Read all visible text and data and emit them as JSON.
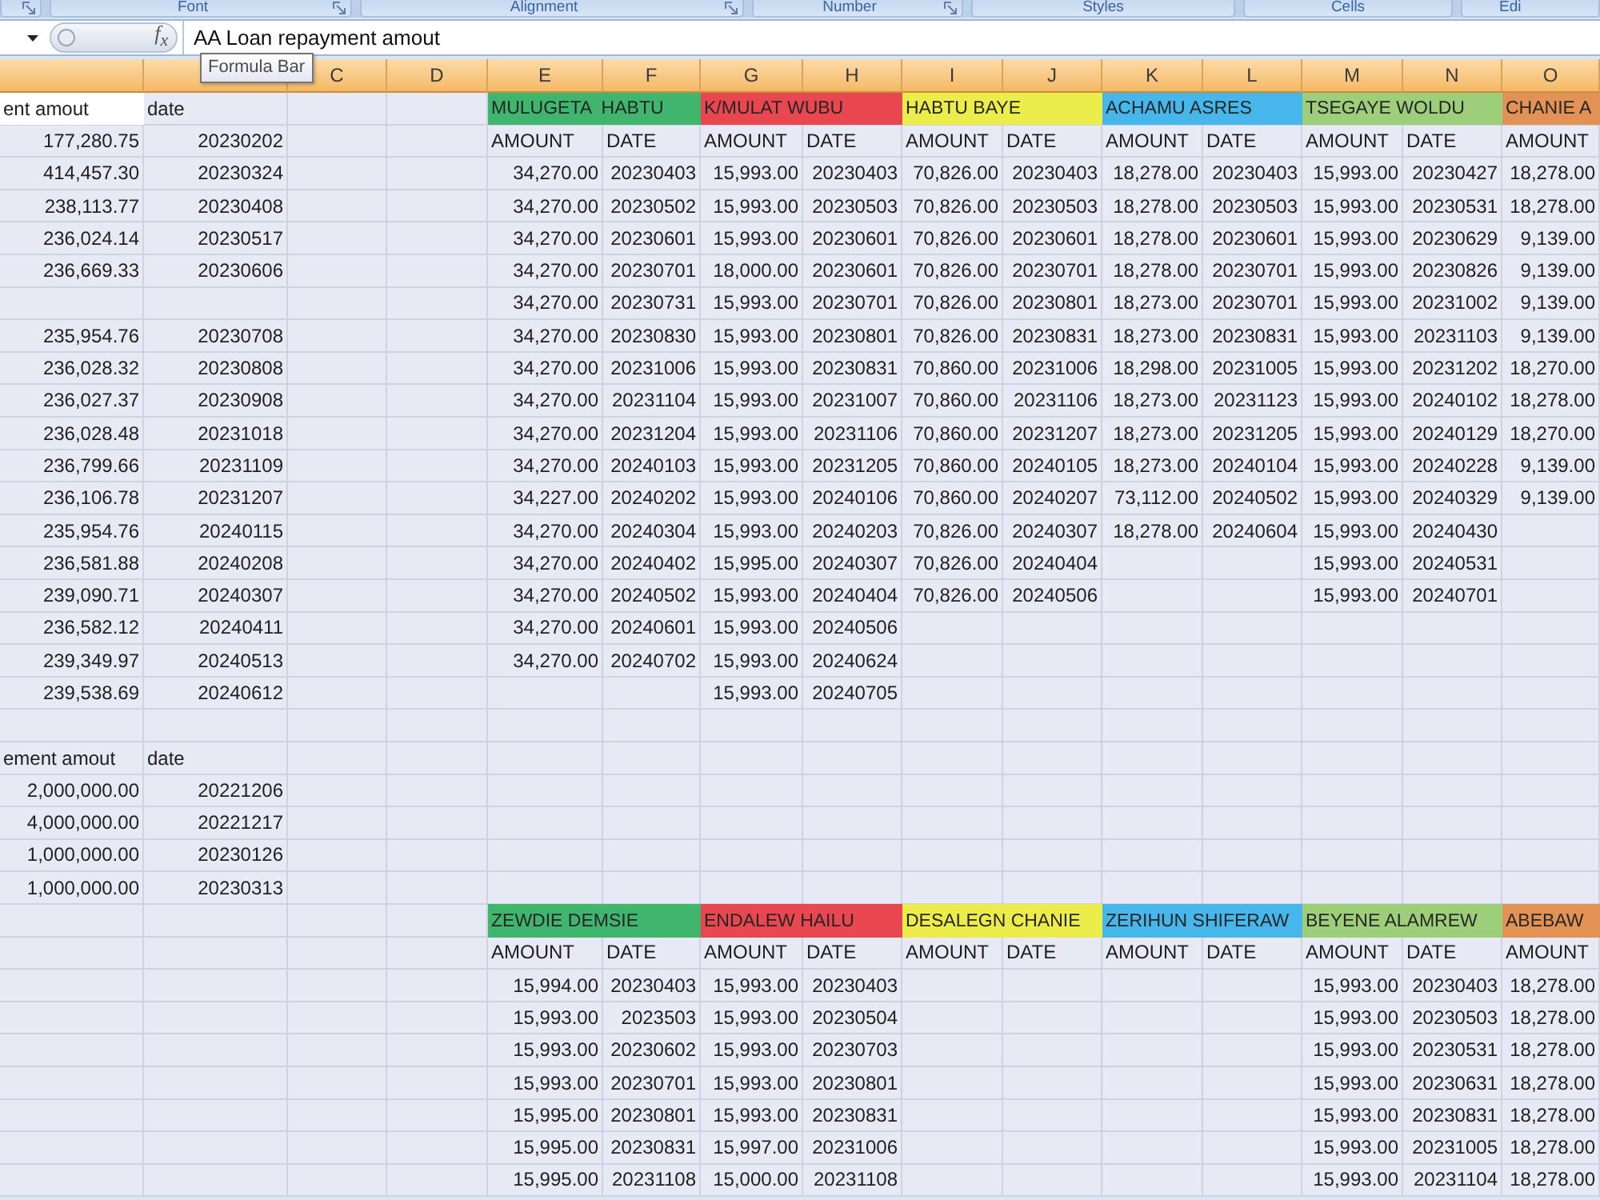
{
  "ribbon_groups": [
    {
      "dialog_launcher": true
    },
    {
      "label": "Font",
      "dialog_launcher": true
    },
    {
      "label": "Alignment",
      "dialog_launcher": true
    },
    {
      "label": "Number",
      "dialog_launcher": true
    },
    {
      "label": "Styles",
      "dialog_launcher": false
    },
    {
      "label": "Cells",
      "dialog_launcher": false
    },
    {
      "label": "Edi",
      "dialog_launcher": false
    }
  ],
  "formula_bar": {
    "function_label": "f$_{x}$",
    "formula": "AA Loan repayment amout",
    "tooltip": "Formula Bar"
  },
  "columns": [
    {
      "selected": true
    },
    {
      "selected": true
    },
    {
      "label": "C",
      "selected": true
    },
    {
      "label": "D",
      "selected": true
    },
    {
      "label": "E",
      "selected": true
    },
    {
      "label": "F",
      "selected": true
    },
    {
      "label": "G",
      "selected": true
    },
    {
      "label": "H",
      "selected": true
    },
    {
      "label": "I",
      "selected": true
    },
    {
      "label": "J",
      "selected": true
    },
    {
      "label": "K",
      "selected": true
    },
    {
      "label": "L",
      "selected": true
    },
    {
      "label": "M",
      "selected": true
    },
    {
      "label": "N",
      "selected": true
    },
    {
      "label": "O",
      "selected": true
    }
  ],
  "rows": [
    {
      "cells": [
        {
          "kind": "text",
          "text": "ent amout",
          "active": true
        },
        {
          "kind": "text",
          "text": "date",
          "active": false
        },
        null,
        null,
        {
          "kind": "name",
          "text": "MULUGETA  HABTU",
          "color": "#3fb56e",
          "active": false
        },
        {
          "kind": "name",
          "text": "K/MULAT WUBU",
          "color": "#e8474f",
          "active": false
        },
        {
          "kind": "name",
          "text": "HABTU BAYE",
          "color": "#ecec4a",
          "active": false
        },
        {
          "kind": "name",
          "text": "ACHAMU ASRES",
          "color": "#47b6ea",
          "active": false
        },
        {
          "kind": "name",
          "text": "TSEGAYE WOLDU",
          "color": "#9dcf7a",
          "active": false
        },
        {
          "kind": "name",
          "text": "CHANIE A",
          "color": "#e39255",
          "active": false
        }
      ]
    },
    {
      "cells": [
        {
          "kind": "number",
          "text": "177,280.75",
          "active": false
        },
        {
          "kind": "number",
          "text": "20230202",
          "active": false
        },
        null,
        null,
        {
          "kind": "text",
          "text": "AMOUNT",
          "active": false
        },
        {
          "kind": "text",
          "text": "DATE",
          "active": false
        },
        {
          "kind": "text",
          "text": "AMOUNT",
          "active": false
        },
        {
          "kind": "text",
          "text": "DATE",
          "active": false
        },
        {
          "kind": "text",
          "text": "AMOUNT",
          "active": false
        },
        {
          "kind": "text",
          "text": "DATE",
          "active": false
        },
        {
          "kind": "text",
          "text": "AMOUNT",
          "active": false
        },
        {
          "kind": "text",
          "text": "DATE",
          "active": false
        },
        {
          "kind": "text",
          "text": "AMOUNT",
          "active": false
        },
        {
          "kind": "text",
          "text": "DATE",
          "active": false
        },
        {
          "kind": "text",
          "text": "AMOUNT",
          "active": false
        }
      ]
    },
    {
      "cells": [
        {
          "kind": "number",
          "text": "414,457.30",
          "active": false
        },
        {
          "kind": "number",
          "text": "20230324",
          "active": false
        },
        null,
        null,
        {
          "kind": "number",
          "text": "34,270.00",
          "active": false
        },
        {
          "kind": "number",
          "text": "20230403",
          "active": false
        },
        {
          "kind": "number",
          "text": "15,993.00",
          "active": false
        },
        {
          "kind": "number",
          "text": "20230403",
          "active": false
        },
        {
          "kind": "number",
          "text": "70,826.00",
          "active": false
        },
        {
          "kind": "number",
          "text": "20230403",
          "active": false
        },
        {
          "kind": "number",
          "text": "18,278.00",
          "active": false
        },
        {
          "kind": "number",
          "text": "20230403",
          "active": false
        },
        {
          "kind": "number",
          "text": "15,993.00",
          "active": false
        },
        {
          "kind": "number",
          "text": "20230427",
          "active": false
        },
        {
          "kind": "number",
          "text": "18,278.00",
          "active": false
        }
      ]
    },
    {
      "cells": [
        {
          "kind": "number",
          "text": "238,113.77",
          "active": false
        },
        {
          "kind": "number",
          "text": "20230408",
          "active": false
        },
        null,
        null,
        {
          "kind": "number",
          "text": "34,270.00",
          "active": false
        },
        {
          "kind": "number",
          "text": "20230502",
          "active": false
        },
        {
          "kind": "number",
          "text": "15,993.00",
          "active": false
        },
        {
          "kind": "number",
          "text": "20230503",
          "active": false
        },
        {
          "kind": "number",
          "text": "70,826.00",
          "active": false
        },
        {
          "kind": "number",
          "text": "20230503",
          "active": false
        },
        {
          "kind": "number",
          "text": "18,278.00",
          "active": false
        },
        {
          "kind": "number",
          "text": "20230503",
          "active": false
        },
        {
          "kind": "number",
          "text": "15,993.00",
          "active": false
        },
        {
          "kind": "number",
          "text": "20230531",
          "active": false
        },
        {
          "kind": "number",
          "text": "18,278.00",
          "active": false
        }
      ]
    },
    {
      "cells": [
        {
          "kind": "number",
          "text": "236,024.14",
          "active": false
        },
        {
          "kind": "number",
          "text": "20230517",
          "active": false
        },
        null,
        null,
        {
          "kind": "number",
          "text": "34,270.00",
          "active": false
        },
        {
          "kind": "number",
          "text": "20230601",
          "active": false
        },
        {
          "kind": "number",
          "text": "15,993.00",
          "active": false
        },
        {
          "kind": "number",
          "text": "20230601",
          "active": false
        },
        {
          "kind": "number",
          "text": "70,826.00",
          "active": false
        },
        {
          "kind": "number",
          "text": "20230601",
          "active": false
        },
        {
          "kind": "number",
          "text": "18,278.00",
          "active": false
        },
        {
          "kind": "number",
          "text": "20230601",
          "active": false
        },
        {
          "kind": "number",
          "text": "15,993.00",
          "active": false
        },
        {
          "kind": "number",
          "text": "20230629",
          "active": false
        },
        {
          "kind": "number",
          "text": "9,139.00",
          "active": false
        }
      ]
    },
    {
      "cells": [
        {
          "kind": "number",
          "text": "236,669.33",
          "active": false
        },
        {
          "kind": "number",
          "text": "20230606",
          "active": false
        },
        null,
        null,
        {
          "kind": "number",
          "text": "34,270.00",
          "active": false
        },
        {
          "kind": "number",
          "text": "20230701",
          "active": false
        },
        {
          "kind": "number",
          "text": "18,000.00",
          "active": false
        },
        {
          "kind": "number",
          "text": "20230601",
          "active": false
        },
        {
          "kind": "number",
          "text": "70,826.00",
          "active": false
        },
        {
          "kind": "number",
          "text": "20230701",
          "active": false
        },
        {
          "kind": "number",
          "text": "18,278.00",
          "active": false
        },
        {
          "kind": "number",
          "text": "20230701",
          "active": false
        },
        {
          "kind": "number",
          "text": "15,993.00",
          "active": false
        },
        {
          "kind": "number",
          "text": "20230826",
          "active": false
        },
        {
          "kind": "number",
          "text": "9,139.00",
          "active": false
        }
      ]
    },
    {
      "cells": [
        null,
        null,
        null,
        null,
        {
          "kind": "number",
          "text": "34,270.00",
          "active": false
        },
        {
          "kind": "number",
          "text": "20230731",
          "active": false
        },
        {
          "kind": "number",
          "text": "15,993.00",
          "active": false
        },
        {
          "kind": "number",
          "text": "20230701",
          "active": false
        },
        {
          "kind": "number",
          "text": "70,826.00",
          "active": false
        },
        {
          "kind": "number",
          "text": "20230801",
          "active": false
        },
        {
          "kind": "number",
          "text": "18,273.00",
          "active": false
        },
        {
          "kind": "number",
          "text": "20230701",
          "active": false
        },
        {
          "kind": "number",
          "text": "15,993.00",
          "active": false
        },
        {
          "kind": "number",
          "text": "20231002",
          "active": false
        },
        {
          "kind": "number",
          "text": "9,139.00",
          "active": false
        }
      ]
    },
    {
      "cells": [
        {
          "kind": "number",
          "text": "235,954.76",
          "active": false
        },
        {
          "kind": "number",
          "text": "20230708",
          "active": false
        },
        null,
        null,
        {
          "kind": "number",
          "text": "34,270.00",
          "active": false
        },
        {
          "kind": "number",
          "text": "20230830",
          "active": false
        },
        {
          "kind": "number",
          "text": "15,993.00",
          "active": false
        },
        {
          "kind": "number",
          "text": "20230801",
          "active": false
        },
        {
          "kind": "number",
          "text": "70,826.00",
          "active": false
        },
        {
          "kind": "number",
          "text": "20230831",
          "active": false
        },
        {
          "kind": "number",
          "text": "18,273.00",
          "active": false
        },
        {
          "kind": "number",
          "text": "20230831",
          "active": false
        },
        {
          "kind": "number",
          "text": "15,993.00",
          "active": false
        },
        {
          "kind": "number",
          "text": "20231103",
          "active": false
        },
        {
          "kind": "number",
          "text": "9,139.00",
          "active": false
        }
      ]
    },
    {
      "cells": [
        {
          "kind": "number",
          "text": "236,028.32",
          "active": false
        },
        {
          "kind": "number",
          "text": "20230808",
          "active": false
        },
        null,
        null,
        {
          "kind": "number",
          "text": "34,270.00",
          "active": false
        },
        {
          "kind": "number",
          "text": "20231006",
          "active": false
        },
        {
          "kind": "number",
          "text": "15,993.00",
          "active": false
        },
        {
          "kind": "number",
          "text": "20230831",
          "active": false
        },
        {
          "kind": "number",
          "text": "70,860.00",
          "active": false
        },
        {
          "kind": "number",
          "text": "20231006",
          "active": false
        },
        {
          "kind": "number",
          "text": "18,298.00",
          "active": false
        },
        {
          "kind": "number",
          "text": "20231005",
          "active": false
        },
        {
          "kind": "number",
          "text": "15,993.00",
          "active": false
        },
        {
          "kind": "number",
          "text": "20231202",
          "active": false
        },
        {
          "kind": "number",
          "text": "18,270.00",
          "active": false
        }
      ]
    },
    {
      "cells": [
        {
          "kind": "number",
          "text": "236,027.37",
          "active": false
        },
        {
          "kind": "number",
          "text": "20230908",
          "active": false
        },
        null,
        null,
        {
          "kind": "number",
          "text": "34,270.00",
          "active": false
        },
        {
          "kind": "number",
          "text": "20231104",
          "active": false
        },
        {
          "kind": "number",
          "text": "15,993.00",
          "active": false
        },
        {
          "kind": "number",
          "text": "20231007",
          "active": false
        },
        {
          "kind": "number",
          "text": "70,860.00",
          "active": false
        },
        {
          "kind": "number",
          "text": "20231106",
          "active": false
        },
        {
          "kind": "number",
          "text": "18,273.00",
          "active": false
        },
        {
          "kind": "number",
          "text": "20231123",
          "active": false
        },
        {
          "kind": "number",
          "text": "15,993.00",
          "active": false
        },
        {
          "kind": "number",
          "text": "20240102",
          "active": false
        },
        {
          "kind": "number",
          "text": "18,278.00",
          "active": false
        }
      ]
    },
    {
      "cells": [
        {
          "kind": "number",
          "text": "236,028.48",
          "active": false
        },
        {
          "kind": "number",
          "text": "20231018",
          "active": false
        },
        null,
        null,
        {
          "kind": "number",
          "text": "34,270.00",
          "active": false
        },
        {
          "kind": "number",
          "text": "20231204",
          "active": false
        },
        {
          "kind": "number",
          "text": "15,993.00",
          "active": false
        },
        {
          "kind": "number",
          "text": "20231106",
          "active": false
        },
        {
          "kind": "number",
          "text": "70,860.00",
          "active": false
        },
        {
          "kind": "number",
          "text": "20231207",
          "active": false
        },
        {
          "kind": "number",
          "text": "18,273.00",
          "active": false
        },
        {
          "kind": "number",
          "text": "20231205",
          "active": false
        },
        {
          "kind": "number",
          "text": "15,993.00",
          "active": false
        },
        {
          "kind": "number",
          "text": "20240129",
          "active": false
        },
        {
          "kind": "number",
          "text": "18,270.00",
          "active": false
        }
      ]
    },
    {
      "cells": [
        {
          "kind": "number",
          "text": "236,799.66",
          "active": false
        },
        {
          "kind": "number",
          "text": "20231109",
          "active": false
        },
        null,
        null,
        {
          "kind": "number",
          "text": "34,270.00",
          "active": false
        },
        {
          "kind": "number",
          "text": "20240103",
          "active": false
        },
        {
          "kind": "number",
          "text": "15,993.00",
          "active": false
        },
        {
          "kind": "number",
          "text": "20231205",
          "active": false
        },
        {
          "kind": "number",
          "text": "70,860.00",
          "active": false
        },
        {
          "kind": "number",
          "text": "20240105",
          "active": false
        },
        {
          "kind": "number",
          "text": "18,273.00",
          "active": false
        },
        {
          "kind": "number",
          "text": "20240104",
          "active": false
        },
        {
          "kind": "number",
          "text": "15,993.00",
          "active": false
        },
        {
          "kind": "number",
          "text": "20240228",
          "active": false
        },
        {
          "kind": "number",
          "text": "9,139.00",
          "active": false
        }
      ]
    },
    {
      "cells": [
        {
          "kind": "number",
          "text": "236,106.78",
          "active": false
        },
        {
          "kind": "number",
          "text": "20231207",
          "active": false
        },
        null,
        null,
        {
          "kind": "number",
          "text": "34,227.00",
          "active": false
        },
        {
          "kind": "number",
          "text": "20240202",
          "active": false
        },
        {
          "kind": "number",
          "text": "15,993.00",
          "active": false
        },
        {
          "kind": "number",
          "text": "20240106",
          "active": false
        },
        {
          "kind": "number",
          "text": "70,860.00",
          "active": false
        },
        {
          "kind": "number",
          "text": "20240207",
          "active": false
        },
        {
          "kind": "number",
          "text": "73,112.00",
          "active": false
        },
        {
          "kind": "number",
          "text": "20240502",
          "active": false
        },
        {
          "kind": "number",
          "text": "15,993.00",
          "active": false
        },
        {
          "kind": "number",
          "text": "20240329",
          "active": false
        },
        {
          "kind": "number",
          "text": "9,139.00",
          "active": false
        }
      ]
    },
    {
      "cells": [
        {
          "kind": "number",
          "text": "235,954.76",
          "active": false
        },
        {
          "kind": "number",
          "text": "20240115",
          "active": false
        },
        null,
        null,
        {
          "kind": "number",
          "text": "34,270.00",
          "active": false
        },
        {
          "kind": "number",
          "text": "20240304",
          "active": false
        },
        {
          "kind": "number",
          "text": "15,993.00",
          "active": false
        },
        {
          "kind": "number",
          "text": "20240203",
          "active": false
        },
        {
          "kind": "number",
          "text": "70,826.00",
          "active": false
        },
        {
          "kind": "number",
          "text": "20240307",
          "active": false
        },
        {
          "kind": "number",
          "text": "18,278.00",
          "active": false
        },
        {
          "kind": "number",
          "text": "20240604",
          "active": false
        },
        {
          "kind": "number",
          "text": "15,993.00",
          "active": false
        },
        {
          "kind": "number",
          "text": "20240430",
          "active": false
        }
      ]
    },
    {
      "cells": [
        {
          "kind": "number",
          "text": "236,581.88",
          "active": false
        },
        {
          "kind": "number",
          "text": "20240208",
          "active": false
        },
        null,
        null,
        {
          "kind": "number",
          "text": "34,270.00",
          "active": false
        },
        {
          "kind": "number",
          "text": "20240402",
          "active": false
        },
        {
          "kind": "number",
          "text": "15,995.00",
          "active": false
        },
        {
          "kind": "number",
          "text": "20240307",
          "active": false
        },
        {
          "kind": "number",
          "text": "70,826.00",
          "active": false
        },
        {
          "kind": "number",
          "text": "20240404",
          "active": false
        },
        null,
        null,
        {
          "kind": "number",
          "text": "15,993.00",
          "active": false
        },
        {
          "kind": "number",
          "text": "20240531",
          "active": false
        }
      ]
    },
    {
      "cells": [
        {
          "kind": "number",
          "text": "239,090.71",
          "active": false
        },
        {
          "kind": "number",
          "text": "20240307",
          "active": false
        },
        null,
        null,
        {
          "kind": "number",
          "text": "34,270.00",
          "active": false
        },
        {
          "kind": "number",
          "text": "20240502",
          "active": false
        },
        {
          "kind": "number",
          "text": "15,993.00",
          "active": false
        },
        {
          "kind": "number",
          "text": "20240404",
          "active": false
        },
        {
          "kind": "number",
          "text": "70,826.00",
          "active": false
        },
        {
          "kind": "number",
          "text": "20240506",
          "active": false
        },
        null,
        null,
        {
          "kind": "number",
          "text": "15,993.00",
          "active": false
        },
        {
          "kind": "number",
          "text": "20240701",
          "active": false
        }
      ]
    },
    {
      "cells": [
        {
          "kind": "number",
          "text": "236,582.12",
          "active": false
        },
        {
          "kind": "number",
          "text": "20240411",
          "active": false
        },
        null,
        null,
        {
          "kind": "number",
          "text": "34,270.00",
          "active": false
        },
        {
          "kind": "number",
          "text": "20240601",
          "active": false
        },
        {
          "kind": "number",
          "text": "15,993.00",
          "active": false
        },
        {
          "kind": "number",
          "text": "20240506",
          "active": false
        }
      ]
    },
    {
      "cells": [
        {
          "kind": "number",
          "text": "239,349.97",
          "active": false
        },
        {
          "kind": "number",
          "text": "20240513",
          "active": false
        },
        null,
        null,
        {
          "kind": "number",
          "text": "34,270.00",
          "active": false
        },
        {
          "kind": "number",
          "text": "20240702",
          "active": false
        },
        {
          "kind": "number",
          "text": "15,993.00",
          "active": false
        },
        {
          "kind": "number",
          "text": "20240624",
          "active": false
        }
      ]
    },
    {
      "cells": [
        {
          "kind": "number",
          "text": "239,538.69",
          "active": false
        },
        {
          "kind": "number",
          "text": "20240612",
          "active": false
        },
        null,
        null,
        null,
        null,
        {
          "kind": "number",
          "text": "15,993.00",
          "active": false
        },
        {
          "kind": "number",
          "text": "20240705",
          "active": false
        }
      ]
    },
    {
      "cells": []
    },
    {
      "cells": [
        {
          "kind": "text",
          "text": "ement amout",
          "active": false
        },
        {
          "kind": "text",
          "text": "date",
          "active": false
        }
      ]
    },
    {
      "cells": [
        {
          "kind": "number",
          "text": "2,000,000.00",
          "active": false
        },
        {
          "kind": "number",
          "text": "20221206",
          "active": false
        }
      ]
    },
    {
      "cells": [
        {
          "kind": "number",
          "text": "4,000,000.00",
          "active": false
        },
        {
          "kind": "number",
          "text": "20221217",
          "active": false
        }
      ]
    },
    {
      "cells": [
        {
          "kind": "number",
          "text": "1,000,000.00",
          "active": false
        },
        {
          "kind": "number",
          "text": "20230126",
          "active": false
        }
      ]
    },
    {
      "cells": [
        {
          "kind": "number",
          "text": "1,000,000.00",
          "active": false
        },
        {
          "kind": "number",
          "text": "20230313",
          "active": false
        }
      ]
    },
    {
      "cells": [
        null,
        null,
        null,
        null,
        {
          "kind": "name",
          "text": "ZEWDIE DEMSIE",
          "color": "#3fb56e",
          "active": false
        },
        {
          "kind": "name",
          "text": "ENDALEW HAILU",
          "color": "#e8474f",
          "active": false
        },
        {
          "kind": "name",
          "text": "DESALEGN CHANIE",
          "color": "#ecec4a",
          "active": false
        },
        {
          "kind": "name",
          "text": "ZERIHUN SHIFERAW",
          "color": "#47b6ea",
          "active": false
        },
        {
          "kind": "name",
          "text": "BEYENE ALAMREW",
          "color": "#9dcf7a",
          "active": false
        },
        {
          "kind": "name",
          "text": "ABEBAW",
          "color": "#e39255",
          "active": false
        }
      ]
    },
    {
      "cells": [
        null,
        null,
        null,
        null,
        {
          "kind": "text",
          "text": "AMOUNT",
          "active": false
        },
        {
          "kind": "text",
          "text": "DATE",
          "active": false
        },
        {
          "kind": "text",
          "text": "AMOUNT",
          "active": false
        },
        {
          "kind": "text",
          "text": "DATE",
          "active": false
        },
        {
          "kind": "text",
          "text": "AMOUNT",
          "active": false
        },
        {
          "kind": "text",
          "text": "DATE",
          "active": false
        },
        {
          "kind": "text",
          "text": "AMOUNT",
          "active": false
        },
        {
          "kind": "text",
          "text": "DATE",
          "active": false
        },
        {
          "kind": "text",
          "text": "AMOUNT",
          "active": false
        },
        {
          "kind": "text",
          "text": "DATE",
          "active": false
        },
        {
          "kind": "text",
          "text": "AMOUNT",
          "active": false
        }
      ]
    },
    {
      "cells": [
        null,
        null,
        null,
        null,
        {
          "kind": "number",
          "text": "15,994.00",
          "active": false
        },
        {
          "kind": "number",
          "text": "20230403",
          "active": false
        },
        {
          "kind": "number",
          "text": "15,993.00",
          "active": false
        },
        {
          "kind": "number",
          "text": "20230403",
          "active": false
        },
        null,
        null,
        null,
        null,
        {
          "kind": "number",
          "text": "15,993.00",
          "active": false
        },
        {
          "kind": "number",
          "text": "20230403",
          "active": false
        },
        {
          "kind": "number",
          "text": "18,278.00",
          "active": false
        }
      ]
    },
    {
      "cells": [
        null,
        null,
        null,
        null,
        {
          "kind": "number",
          "text": "15,993.00",
          "active": false
        },
        {
          "kind": "number",
          "text": "2023503",
          "active": false
        },
        {
          "kind": "number",
          "text": "15,993.00",
          "active": false
        },
        {
          "kind": "number",
          "text": "20230504",
          "active": false
        },
        null,
        null,
        null,
        null,
        {
          "kind": "number",
          "text": "15,993.00",
          "active": false
        },
        {
          "kind": "number",
          "text": "20230503",
          "active": false
        },
        {
          "kind": "number",
          "text": "18,278.00",
          "active": false
        }
      ]
    },
    {
      "cells": [
        null,
        null,
        null,
        null,
        {
          "kind": "number",
          "text": "15,993.00",
          "active": false
        },
        {
          "kind": "number",
          "text": "20230602",
          "active": false
        },
        {
          "kind": "number",
          "text": "15,993.00",
          "active": false
        },
        {
          "kind": "number",
          "text": "20230703",
          "active": false
        },
        null,
        null,
        null,
        null,
        {
          "kind": "number",
          "text": "15,993.00",
          "active": false
        },
        {
          "kind": "number",
          "text": "20230531",
          "active": false
        },
        {
          "kind": "number",
          "text": "18,278.00",
          "active": false
        }
      ]
    },
    {
      "cells": [
        null,
        null,
        null,
        null,
        {
          "kind": "number",
          "text": "15,993.00",
          "active": false
        },
        {
          "kind": "number",
          "text": "20230701",
          "active": false
        },
        {
          "kind": "number",
          "text": "15,993.00",
          "active": false
        },
        {
          "kind": "number",
          "text": "20230801",
          "active": false
        },
        null,
        null,
        null,
        null,
        {
          "kind": "number",
          "text": "15,993.00",
          "active": false
        },
        {
          "kind": "number",
          "text": "20230631",
          "active": false
        },
        {
          "kind": "number",
          "text": "18,278.00",
          "active": false
        }
      ]
    },
    {
      "cells": [
        null,
        null,
        null,
        null,
        {
          "kind": "number",
          "text": "15,995.00",
          "active": false
        },
        {
          "kind": "number",
          "text": "20230801",
          "active": false
        },
        {
          "kind": "number",
          "text": "15,993.00",
          "active": false
        },
        {
          "kind": "number",
          "text": "20230831",
          "active": false
        },
        null,
        null,
        null,
        null,
        {
          "kind": "number",
          "text": "15,993.00",
          "active": false
        },
        {
          "kind": "number",
          "text": "20230831",
          "active": false
        },
        {
          "kind": "number",
          "text": "18,278.00",
          "active": false
        }
      ]
    },
    {
      "cells": [
        null,
        null,
        null,
        null,
        {
          "kind": "number",
          "text": "15,995.00",
          "active": false
        },
        {
          "kind": "number",
          "text": "20230831",
          "active": false
        },
        {
          "kind": "number",
          "text": "15,997.00",
          "active": false
        },
        {
          "kind": "number",
          "text": "20231006",
          "active": false
        },
        null,
        null,
        null,
        null,
        {
          "kind": "number",
          "text": "15,993.00",
          "active": false
        },
        {
          "kind": "number",
          "text": "20231005",
          "active": false
        },
        {
          "kind": "number",
          "text": "18,278.00",
          "active": false
        }
      ]
    },
    {
      "cells": [
        null,
        null,
        null,
        null,
        {
          "kind": "number",
          "text": "15,995.00",
          "active": false
        },
        {
          "kind": "number",
          "text": "20231108",
          "active": false
        },
        {
          "kind": "number",
          "text": "15,000.00",
          "active": false
        },
        {
          "kind": "number",
          "text": "20231108",
          "active": false
        },
        null,
        null,
        null,
        null,
        {
          "kind": "number",
          "text": "15,993.00",
          "active": false
        },
        {
          "kind": "number",
          "text": "20231104",
          "active": false
        },
        {
          "kind": "number",
          "text": "18,278.00",
          "active": false
        }
      ]
    }
  ]
}
